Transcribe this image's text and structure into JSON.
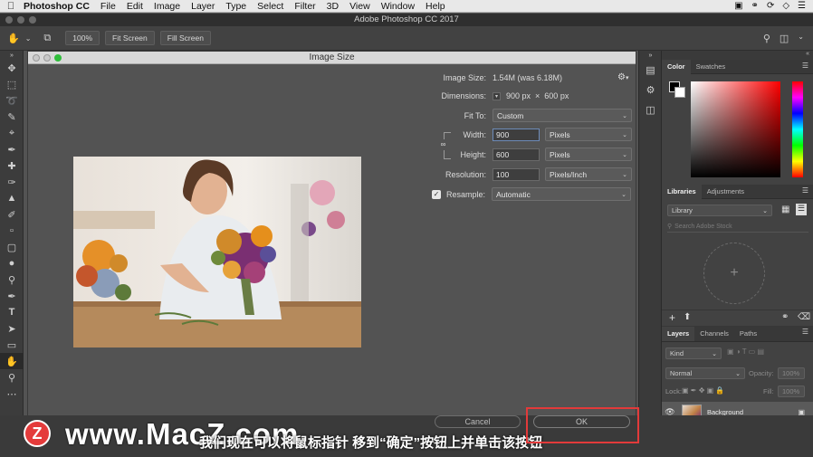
{
  "menubar": {
    "app": "Photoshop CC",
    "items": [
      "File",
      "Edit",
      "Image",
      "Layer",
      "Type",
      "Select",
      "Filter",
      "3D",
      "View",
      "Window",
      "Help"
    ]
  },
  "app_title": "Adobe Photoshop CC 2017",
  "options": {
    "zoom": "100%",
    "fit_screen": "Fit Screen",
    "fill_screen": "Fill Screen"
  },
  "dialog": {
    "title": "Image Size",
    "image_size_label": "Image Size:",
    "image_size_value": "1.54M (was 6.18M)",
    "dimensions_label": "Dimensions:",
    "dim_w": "900 px",
    "dim_x": "×",
    "dim_h": "600 px",
    "fit_to_label": "Fit To:",
    "fit_to_value": "Custom",
    "width_label": "Width:",
    "width_value": "900",
    "width_unit": "Pixels",
    "height_label": "Height:",
    "height_value": "600",
    "height_unit": "Pixels",
    "resolution_label": "Resolution:",
    "resolution_value": "100",
    "resolution_unit": "Pixels/Inch",
    "resample_label": "Resample:",
    "resample_value": "Automatic",
    "cancel": "Cancel",
    "ok": "OK"
  },
  "panels": {
    "color_tabs": [
      "Color",
      "Swatches"
    ],
    "lib_tabs": [
      "Libraries",
      "Adjustments"
    ],
    "library_select": "Library",
    "search_placeholder": "Search Adobe Stock",
    "layers_tabs": [
      "Layers",
      "Channels",
      "Paths"
    ],
    "kind": "Kind",
    "blend": "Normal",
    "opacity_label": "Opacity:",
    "opacity_value": "100%",
    "lock_label": "Lock:",
    "fill_label": "Fill:",
    "fill_value": "100%",
    "layer_name": "Background"
  },
  "overlay": {
    "watermark": "www.MacZ.com",
    "logo_letter": "Z",
    "subtitle": "我们现在可以将鼠标指针 移到“确定”按钮上并单击该按钮"
  },
  "colors": {
    "highlight": "#e23a3a"
  }
}
